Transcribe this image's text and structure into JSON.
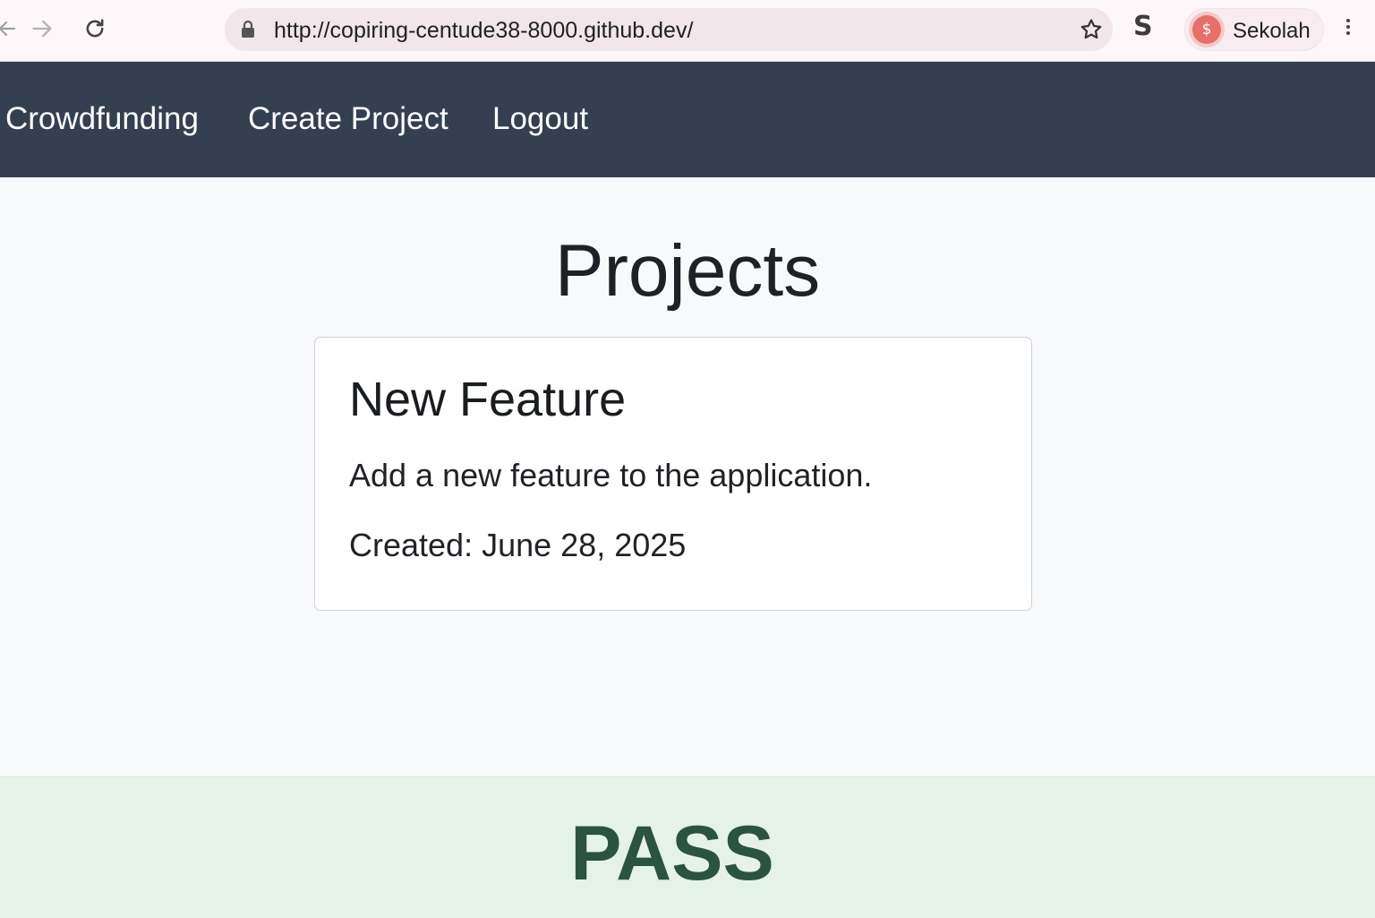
{
  "browser": {
    "url": "http://copiring-centude38-8000.github.dev/",
    "extension_label": "S",
    "profile": {
      "avatar_symbol": "$",
      "name": "Sekolah"
    },
    "icons": [
      "back-icon",
      "forward-icon",
      "reload-icon",
      "lock-icon",
      "star-icon",
      "menu-icon"
    ]
  },
  "navbar": {
    "brand": "Crowdfunding",
    "links": [
      "Create Project",
      "Logout"
    ],
    "background": "#343f52"
  },
  "main": {
    "title": "Projects",
    "projects": [
      {
        "name": "New Feature",
        "description": "Add a new feature to the application.",
        "created": "Created: June 28, 2025"
      }
    ]
  },
  "result": {
    "label": "PASS",
    "color": "#2a5440",
    "background": "#e5f3e6"
  }
}
